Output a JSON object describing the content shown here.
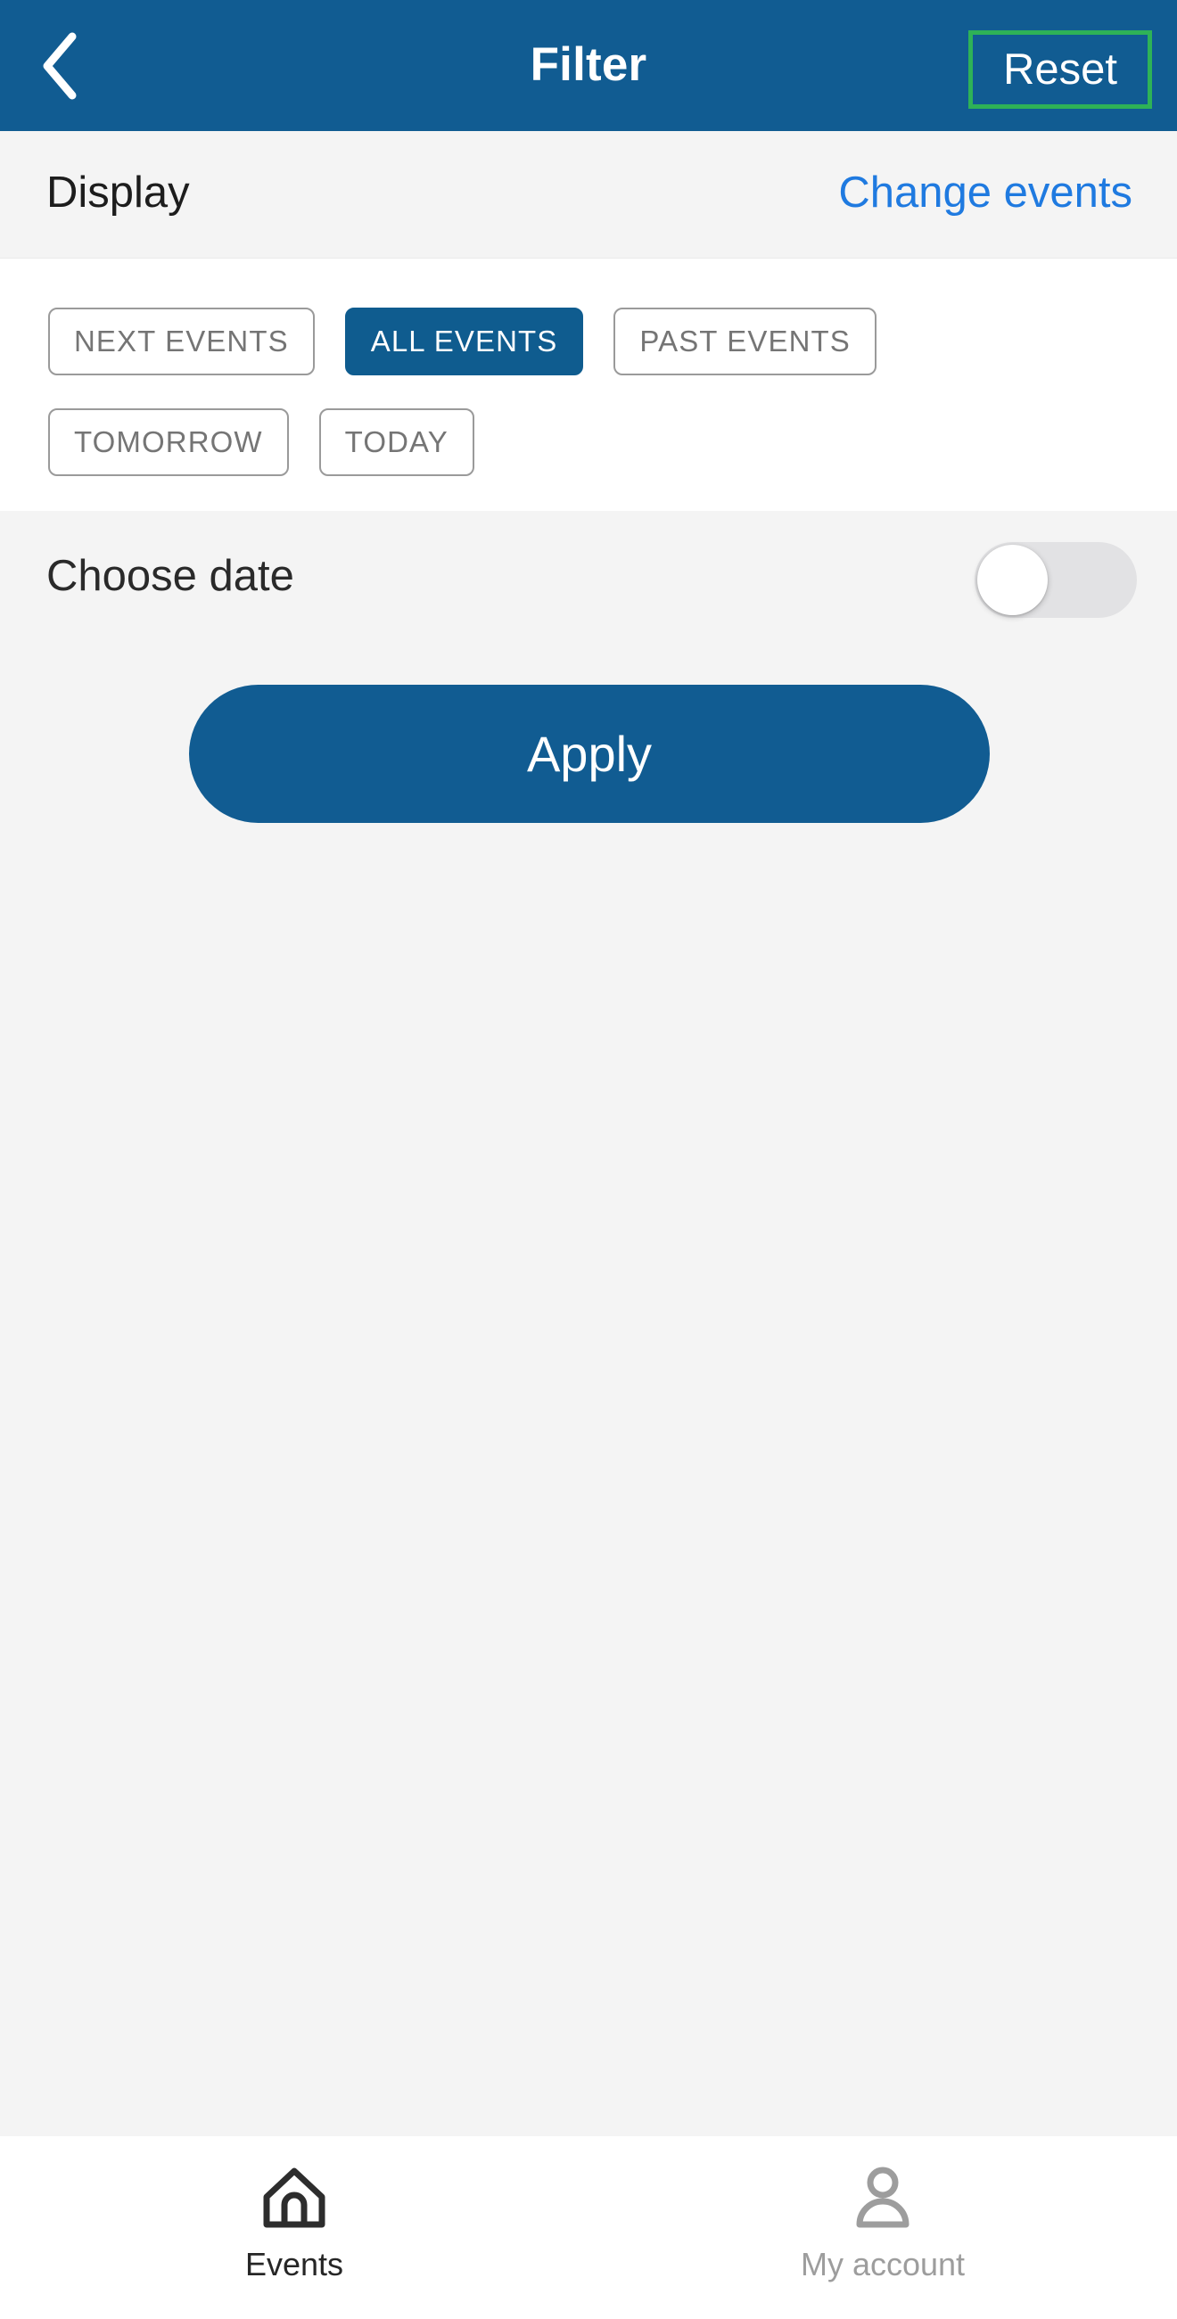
{
  "header": {
    "back_icon": "chevron-left-icon",
    "title": "Filter",
    "reset_label": "Reset",
    "bg_color": "#115c92",
    "highlight_color": "#2eb257"
  },
  "display_section": {
    "label": "Display",
    "action_label": "Change events",
    "action_color": "#1f7ae0"
  },
  "filter_chips": {
    "row1": [
      {
        "label": "NEXT EVENTS",
        "selected": false
      },
      {
        "label": "ALL EVENTS",
        "selected": true
      },
      {
        "label": "PAST EVENTS",
        "selected": false
      }
    ],
    "row2": [
      {
        "label": "TOMORROW",
        "selected": false
      },
      {
        "label": "TODAY",
        "selected": false
      }
    ],
    "selected_color": "#0f5c8f",
    "unselected_text_color": "#757575"
  },
  "choose_date": {
    "label": "Choose date",
    "toggle_state": "off",
    "track_color": "#e2e2e4",
    "knob_color": "#ffffff"
  },
  "apply": {
    "label": "Apply",
    "color": "#115c92"
  },
  "bottom_nav": {
    "items": [
      {
        "label": "Events",
        "icon": "home-icon",
        "active": true
      },
      {
        "label": "My account",
        "icon": "person-icon",
        "active": false
      }
    ]
  }
}
